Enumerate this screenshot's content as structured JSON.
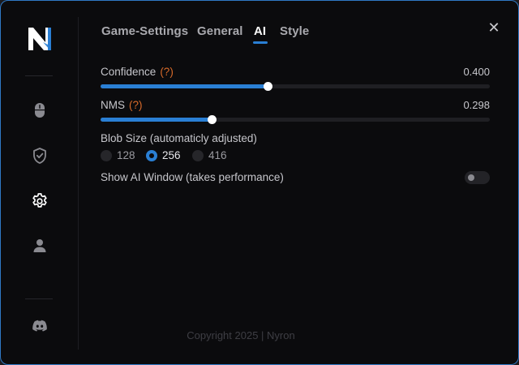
{
  "window": {
    "close_glyph": "✕"
  },
  "sidebar": {
    "logo_icon": "nyron-logo",
    "items": [
      {
        "icon": "mouse-icon"
      },
      {
        "icon": "shield-icon"
      },
      {
        "icon": "gear-icon",
        "active": true
      },
      {
        "icon": "user-icon"
      }
    ],
    "bottom_icon": "discord-icon"
  },
  "tabs": [
    {
      "label": "Game-Settings"
    },
    {
      "label": "General"
    },
    {
      "label": "AI",
      "active": true
    },
    {
      "label": "Style"
    }
  ],
  "settings": {
    "confidence": {
      "label": "Confidence",
      "help": "(?)",
      "value_text": "0.400",
      "value": 0.4,
      "fill_fraction": 0.43
    },
    "nms": {
      "label": "NMS",
      "help": "(?)",
      "value_text": "0.298",
      "value": 0.298,
      "fill_fraction": 0.285
    },
    "blob_size": {
      "label": "Blob Size (automaticly adjusted)",
      "options": [
        "128",
        "256",
        "416"
      ],
      "selected": "256"
    },
    "show_ai_window": {
      "label": "Show AI Window (takes performance)",
      "enabled": false
    }
  },
  "footer": {
    "text": "Copyright 2025 | Nyron"
  },
  "colors": {
    "accent": "#2a7fd4",
    "help": "#d96b2a",
    "background": "#0b0b0d",
    "border": "#2f78c4"
  }
}
